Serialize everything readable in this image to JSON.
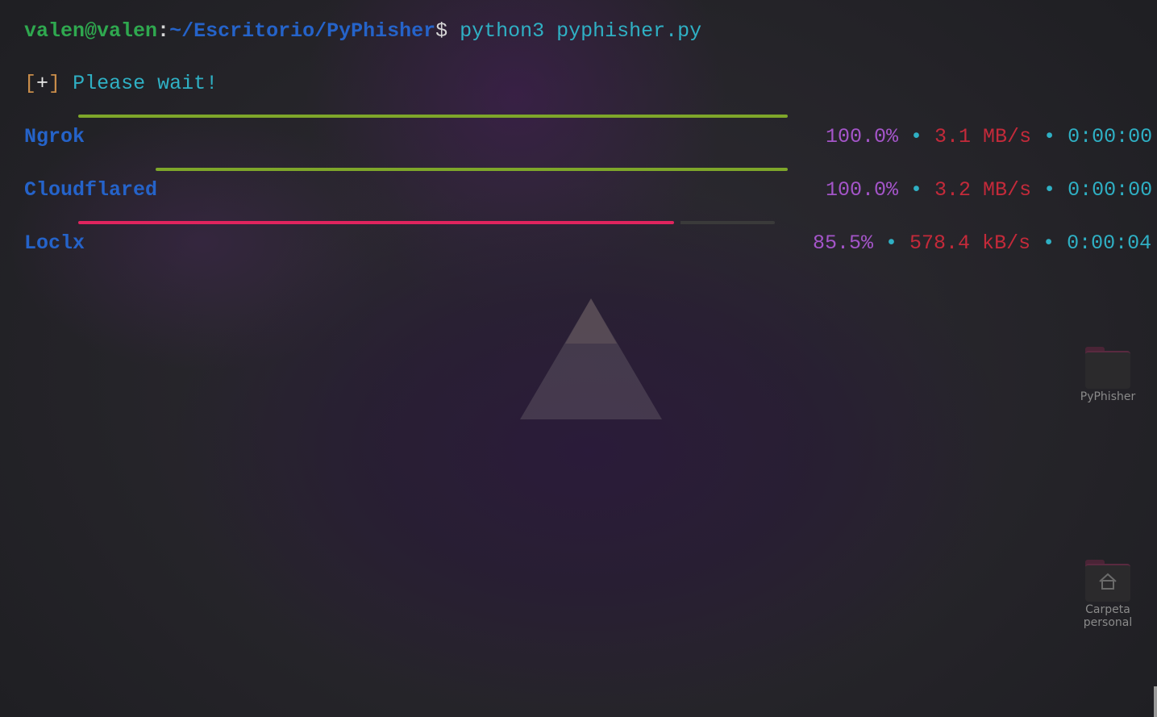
{
  "terminal": {
    "prompt": {
      "user_host": "valen@valen",
      "colon": ":",
      "path": "~/Escritorio/PyPhisher",
      "dollar": "$ ",
      "command": "python3 pyphisher.py"
    },
    "status": {
      "open_bracket": "[",
      "symbol": "+",
      "close_bracket": "]",
      "message": " Please wait!"
    },
    "downloads": [
      {
        "label": "Ngrok",
        "progress": 1.0,
        "percent": "100.0%",
        "speed": "3.1 MB/s",
        "eta": "0:00:00",
        "bar_color": "#7ea62a"
      },
      {
        "label": "Cloudflared",
        "progress": 1.0,
        "percent": "100.0%",
        "speed": "3.2 MB/s",
        "eta": "0:00:00",
        "bar_color": "#7ea62a"
      },
      {
        "label": "Loclx",
        "progress": 0.855,
        "percent": "85.5%",
        "speed": "578.4 kB/s",
        "eta": "0:00:04",
        "bar_color": "#e0245e",
        "track_color": "#3a3a3a"
      }
    ],
    "separator": " • "
  },
  "desktop": {
    "icons": [
      {
        "label": "PyPhisher",
        "icon": "folder-icon"
      },
      {
        "label": "Carpeta personal",
        "icon": "home-folder-icon"
      }
    ]
  },
  "colors": {
    "background": "#2a2930",
    "prompt_user": "#2fa84f",
    "prompt_path": "#2563c9",
    "command": "#2fb0c4",
    "percent": "#a455c9",
    "speed": "#c42a3a"
  }
}
